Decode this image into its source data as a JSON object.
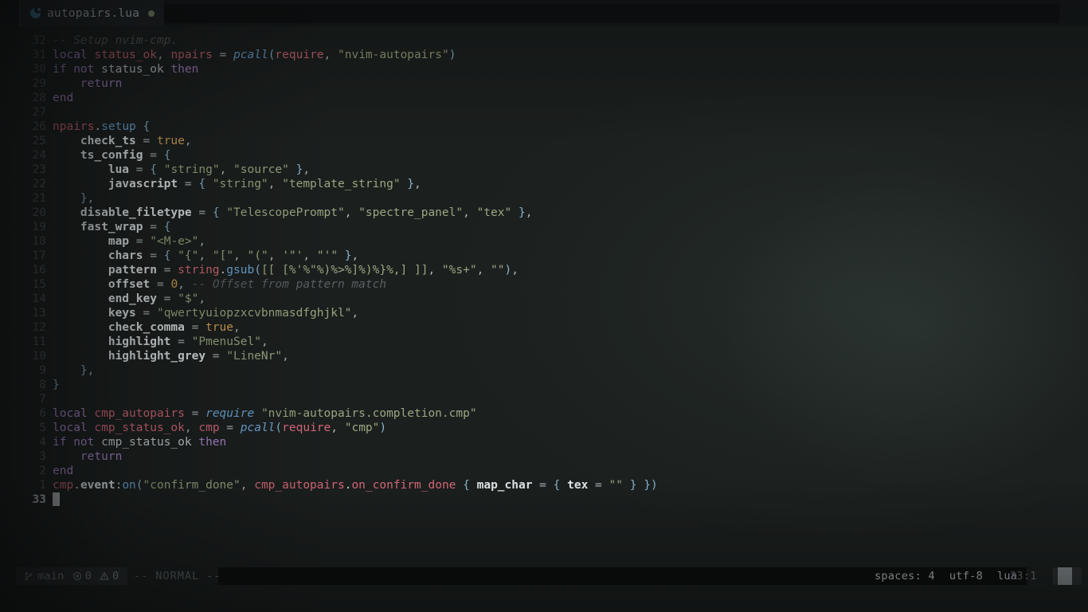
{
  "app": {
    "name": "neovim-editor",
    "theme_bg": "#1b1f1e"
  },
  "tabline": {
    "tabs": [
      {
        "icon": "lua-moon-icon",
        "filename": "autopairs.lua",
        "modified": true,
        "modified_indicator": "●",
        "active": true
      }
    ]
  },
  "editor": {
    "filetype": "lua",
    "cursor_line_number": "33",
    "lines": [
      {
        "num": "32",
        "tokens": [
          {
            "t": "-- Setup nvim-cmp.",
            "c": "c-cmt"
          }
        ]
      },
      {
        "num": "31",
        "tokens": [
          {
            "t": "local ",
            "c": "c-kw"
          },
          {
            "t": "status_ok",
            "c": "c-var"
          },
          {
            "t": ", ",
            "c": "c-op"
          },
          {
            "t": "npairs",
            "c": "c-var"
          },
          {
            "t": " = ",
            "c": "c-op"
          },
          {
            "t": "pcall",
            "c": "c-fni"
          },
          {
            "t": "(",
            "c": "c-punct"
          },
          {
            "t": "require",
            "c": "c-var"
          },
          {
            "t": ", ",
            "c": "c-op"
          },
          {
            "t": "\"nvim-autopairs\"",
            "c": "c-str"
          },
          {
            "t": ")",
            "c": "c-punct"
          }
        ]
      },
      {
        "num": "30",
        "tokens": [
          {
            "t": "if ",
            "c": "c-kw"
          },
          {
            "t": "not ",
            "c": "c-kw"
          },
          {
            "t": "status_ok ",
            "c": "c-plain"
          },
          {
            "t": "then",
            "c": "c-kw"
          }
        ]
      },
      {
        "num": "29",
        "tokens": [
          {
            "t": "    ",
            "c": "c-plain"
          },
          {
            "t": "return",
            "c": "c-kw"
          }
        ]
      },
      {
        "num": "28",
        "tokens": [
          {
            "t": "end",
            "c": "c-kw"
          }
        ]
      },
      {
        "num": "27",
        "tokens": []
      },
      {
        "num": "26",
        "tokens": [
          {
            "t": "npairs",
            "c": "c-var"
          },
          {
            "t": ".",
            "c": "c-plain"
          },
          {
            "t": "setup",
            "c": "c-fn"
          },
          {
            "t": " ",
            "c": "c-plain"
          },
          {
            "t": "{",
            "c": "c-punct"
          }
        ]
      },
      {
        "num": "25",
        "tokens": [
          {
            "t": "    ",
            "c": "c-plain"
          },
          {
            "t": "check_ts",
            "c": "c-fld"
          },
          {
            "t": " = ",
            "c": "c-op"
          },
          {
            "t": "true",
            "c": "c-bool"
          },
          {
            "t": ",",
            "c": "c-op"
          }
        ]
      },
      {
        "num": "24",
        "tokens": [
          {
            "t": "    ",
            "c": "c-plain"
          },
          {
            "t": "ts_config",
            "c": "c-fld"
          },
          {
            "t": " = ",
            "c": "c-op"
          },
          {
            "t": "{",
            "c": "c-punct"
          }
        ]
      },
      {
        "num": "23",
        "tokens": [
          {
            "t": "        ",
            "c": "c-plain"
          },
          {
            "t": "lua",
            "c": "c-fld"
          },
          {
            "t": " = ",
            "c": "c-op"
          },
          {
            "t": "{ ",
            "c": "c-punct"
          },
          {
            "t": "\"string\"",
            "c": "c-str"
          },
          {
            "t": ", ",
            "c": "c-op"
          },
          {
            "t": "\"source\"",
            "c": "c-str"
          },
          {
            "t": " }",
            "c": "c-punct"
          },
          {
            "t": ",",
            "c": "c-op"
          }
        ]
      },
      {
        "num": "22",
        "tokens": [
          {
            "t": "        ",
            "c": "c-plain"
          },
          {
            "t": "javascript",
            "c": "c-fld"
          },
          {
            "t": " = ",
            "c": "c-op"
          },
          {
            "t": "{ ",
            "c": "c-punct"
          },
          {
            "t": "\"string\"",
            "c": "c-str"
          },
          {
            "t": ", ",
            "c": "c-op"
          },
          {
            "t": "\"template_string\"",
            "c": "c-str"
          },
          {
            "t": " }",
            "c": "c-punct"
          },
          {
            "t": ",",
            "c": "c-op"
          }
        ]
      },
      {
        "num": "21",
        "tokens": [
          {
            "t": "    ",
            "c": "c-plain"
          },
          {
            "t": "}",
            "c": "c-punct"
          },
          {
            "t": ",",
            "c": "c-op"
          }
        ]
      },
      {
        "num": "20",
        "tokens": [
          {
            "t": "    ",
            "c": "c-plain"
          },
          {
            "t": "disable_filetype",
            "c": "c-fld"
          },
          {
            "t": " = ",
            "c": "c-op"
          },
          {
            "t": "{ ",
            "c": "c-punct"
          },
          {
            "t": "\"TelescopePrompt\"",
            "c": "c-str"
          },
          {
            "t": ", ",
            "c": "c-op"
          },
          {
            "t": "\"spectre_panel\"",
            "c": "c-str"
          },
          {
            "t": ", ",
            "c": "c-op"
          },
          {
            "t": "\"tex\"",
            "c": "c-str"
          },
          {
            "t": " }",
            "c": "c-punct"
          },
          {
            "t": ",",
            "c": "c-op"
          }
        ]
      },
      {
        "num": "19",
        "tokens": [
          {
            "t": "    ",
            "c": "c-plain"
          },
          {
            "t": "fast_wrap",
            "c": "c-fld"
          },
          {
            "t": " = ",
            "c": "c-op"
          },
          {
            "t": "{",
            "c": "c-punct"
          }
        ]
      },
      {
        "num": "18",
        "tokens": [
          {
            "t": "        ",
            "c": "c-plain"
          },
          {
            "t": "map",
            "c": "c-fld"
          },
          {
            "t": " = ",
            "c": "c-op"
          },
          {
            "t": "\"<M-e>\"",
            "c": "c-str"
          },
          {
            "t": ",",
            "c": "c-op"
          }
        ]
      },
      {
        "num": "17",
        "tokens": [
          {
            "t": "        ",
            "c": "c-plain"
          },
          {
            "t": "chars",
            "c": "c-fld"
          },
          {
            "t": " = ",
            "c": "c-op"
          },
          {
            "t": "{ ",
            "c": "c-punct"
          },
          {
            "t": "\"{\"",
            "c": "c-str"
          },
          {
            "t": ", ",
            "c": "c-op"
          },
          {
            "t": "\"[\"",
            "c": "c-str"
          },
          {
            "t": ", ",
            "c": "c-op"
          },
          {
            "t": "\"(\"",
            "c": "c-str"
          },
          {
            "t": ", ",
            "c": "c-op"
          },
          {
            "t": "'\"'",
            "c": "c-str"
          },
          {
            "t": ", ",
            "c": "c-op"
          },
          {
            "t": "\"'\"",
            "c": "c-str"
          },
          {
            "t": " }",
            "c": "c-punct"
          },
          {
            "t": ",",
            "c": "c-op"
          }
        ]
      },
      {
        "num": "16",
        "tokens": [
          {
            "t": "        ",
            "c": "c-plain"
          },
          {
            "t": "pattern",
            "c": "c-fld"
          },
          {
            "t": " = ",
            "c": "c-op"
          },
          {
            "t": "string",
            "c": "c-var"
          },
          {
            "t": ".",
            "c": "c-plain"
          },
          {
            "t": "gsub",
            "c": "c-fn"
          },
          {
            "t": "(",
            "c": "c-punct"
          },
          {
            "t": "[[ [%'%\"%)%>%]%)%}%,] ]]",
            "c": "c-str"
          },
          {
            "t": ", ",
            "c": "c-op"
          },
          {
            "t": "\"%s+\"",
            "c": "c-str"
          },
          {
            "t": ", ",
            "c": "c-op"
          },
          {
            "t": "\"\"",
            "c": "c-str"
          },
          {
            "t": ")",
            "c": "c-punct"
          },
          {
            "t": ",",
            "c": "c-op"
          }
        ]
      },
      {
        "num": "15",
        "tokens": [
          {
            "t": "        ",
            "c": "c-plain"
          },
          {
            "t": "offset",
            "c": "c-fld"
          },
          {
            "t": " = ",
            "c": "c-op"
          },
          {
            "t": "0",
            "c": "c-num"
          },
          {
            "t": ", ",
            "c": "c-op"
          },
          {
            "t": "-- Offset from pattern match",
            "c": "c-cmt"
          }
        ]
      },
      {
        "num": "14",
        "tokens": [
          {
            "t": "        ",
            "c": "c-plain"
          },
          {
            "t": "end_key",
            "c": "c-fld"
          },
          {
            "t": " = ",
            "c": "c-op"
          },
          {
            "t": "\"$\"",
            "c": "c-str"
          },
          {
            "t": ",",
            "c": "c-op"
          }
        ]
      },
      {
        "num": "13",
        "tokens": [
          {
            "t": "        ",
            "c": "c-plain"
          },
          {
            "t": "keys",
            "c": "c-fld"
          },
          {
            "t": " = ",
            "c": "c-op"
          },
          {
            "t": "\"qwertyuiopzxcvbnmasdfghjkl\"",
            "c": "c-str"
          },
          {
            "t": ",",
            "c": "c-op"
          }
        ]
      },
      {
        "num": "12",
        "tokens": [
          {
            "t": "        ",
            "c": "c-plain"
          },
          {
            "t": "check_comma",
            "c": "c-fld"
          },
          {
            "t": " = ",
            "c": "c-op"
          },
          {
            "t": "true",
            "c": "c-bool"
          },
          {
            "t": ",",
            "c": "c-op"
          }
        ]
      },
      {
        "num": "11",
        "tokens": [
          {
            "t": "        ",
            "c": "c-plain"
          },
          {
            "t": "highlight",
            "c": "c-fld"
          },
          {
            "t": " = ",
            "c": "c-op"
          },
          {
            "t": "\"PmenuSel\"",
            "c": "c-str"
          },
          {
            "t": ",",
            "c": "c-op"
          }
        ]
      },
      {
        "num": "10",
        "tokens": [
          {
            "t": "        ",
            "c": "c-plain"
          },
          {
            "t": "highlight_grey",
            "c": "c-fld"
          },
          {
            "t": " = ",
            "c": "c-op"
          },
          {
            "t": "\"LineNr\"",
            "c": "c-str"
          },
          {
            "t": ",",
            "c": "c-op"
          }
        ]
      },
      {
        "num": "9",
        "tokens": [
          {
            "t": "    ",
            "c": "c-plain"
          },
          {
            "t": "}",
            "c": "c-punct"
          },
          {
            "t": ",",
            "c": "c-op"
          }
        ]
      },
      {
        "num": "8",
        "tokens": [
          {
            "t": "}",
            "c": "c-punct"
          }
        ]
      },
      {
        "num": "7",
        "tokens": []
      },
      {
        "num": "6",
        "tokens": [
          {
            "t": "local ",
            "c": "c-kw"
          },
          {
            "t": "cmp_autopairs",
            "c": "c-var"
          },
          {
            "t": " = ",
            "c": "c-op"
          },
          {
            "t": "require",
            "c": "c-fni"
          },
          {
            "t": " ",
            "c": "c-plain"
          },
          {
            "t": "\"nvim-autopairs.completion.cmp\"",
            "c": "c-str"
          }
        ]
      },
      {
        "num": "5",
        "tokens": [
          {
            "t": "local ",
            "c": "c-kw"
          },
          {
            "t": "cmp_status_ok",
            "c": "c-var"
          },
          {
            "t": ", ",
            "c": "c-op"
          },
          {
            "t": "cmp",
            "c": "c-var"
          },
          {
            "t": " = ",
            "c": "c-op"
          },
          {
            "t": "pcall",
            "c": "c-fni"
          },
          {
            "t": "(",
            "c": "c-punct"
          },
          {
            "t": "require",
            "c": "c-var"
          },
          {
            "t": ", ",
            "c": "c-op"
          },
          {
            "t": "\"cmp\"",
            "c": "c-str"
          },
          {
            "t": ")",
            "c": "c-punct"
          }
        ]
      },
      {
        "num": "4",
        "tokens": [
          {
            "t": "if ",
            "c": "c-kw"
          },
          {
            "t": "not ",
            "c": "c-kw"
          },
          {
            "t": "cmp_status_ok ",
            "c": "c-plain"
          },
          {
            "t": "then",
            "c": "c-kw"
          }
        ]
      },
      {
        "num": "3",
        "tokens": [
          {
            "t": "    ",
            "c": "c-plain"
          },
          {
            "t": "return",
            "c": "c-kw"
          }
        ]
      },
      {
        "num": "2",
        "tokens": [
          {
            "t": "end",
            "c": "c-kw"
          }
        ]
      },
      {
        "num": "1",
        "tokens": [
          {
            "t": "cmp",
            "c": "c-var"
          },
          {
            "t": ".",
            "c": "c-plain"
          },
          {
            "t": "event",
            "c": "c-fld"
          },
          {
            "t": ":",
            "c": "c-plain"
          },
          {
            "t": "on",
            "c": "c-fn"
          },
          {
            "t": "(",
            "c": "c-punct"
          },
          {
            "t": "\"confirm_done\"",
            "c": "c-str"
          },
          {
            "t": ", ",
            "c": "c-op"
          },
          {
            "t": "cmp_autopairs",
            "c": "c-var"
          },
          {
            "t": ".",
            "c": "c-plain"
          },
          {
            "t": "on_confirm_done",
            "c": "c-var"
          },
          {
            "t": " ",
            "c": "c-plain"
          },
          {
            "t": "{ ",
            "c": "c-punct"
          },
          {
            "t": "map_char",
            "c": "c-fld"
          },
          {
            "t": " = ",
            "c": "c-op"
          },
          {
            "t": "{ ",
            "c": "c-punct"
          },
          {
            "t": "tex",
            "c": "c-fld"
          },
          {
            "t": " = ",
            "c": "c-op"
          },
          {
            "t": "\"\"",
            "c": "c-str"
          },
          {
            "t": " } ",
            "c": "c-punct"
          },
          {
            "t": "}",
            "c": "c-punct"
          },
          {
            "t": ")",
            "c": "c-punct"
          }
        ]
      },
      {
        "num": "33",
        "tokens": [],
        "cursor": true,
        "current": true
      }
    ]
  },
  "statusline": {
    "git_icon": "git-branch-icon",
    "git_branch": "main",
    "error_icon": "error-circle-icon",
    "error_count": "0",
    "warning_icon": "warning-triangle-icon",
    "warning_count": "0",
    "mode": "-- NORMAL --",
    "indent": "spaces: 4",
    "encoding": "utf-8",
    "filetype": "lua",
    "position": "33:1"
  }
}
